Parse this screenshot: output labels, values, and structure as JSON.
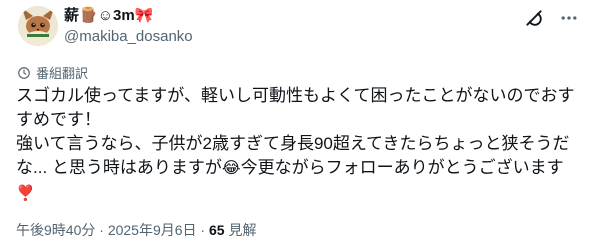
{
  "author": {
    "display_name": "薪",
    "name_decoration": "🪵☺3m🎀",
    "handle": "@makiba_dosanko"
  },
  "icons": {
    "avatar": "eevee-avatar",
    "grok": "grok-icon",
    "more": "more-icon",
    "translate": "translate-icon"
  },
  "translate_label": "番組翻訳",
  "tweet": {
    "line1": "スゴカル使ってますが、軽いし可動性もよくて困ったことがないのでおすすめです！",
    "line2_a": "強いて言うなら、子供が2歳すぎて身長90超えてきたらちょっと狭そうだな... と思う時はありますが",
    "emoji": "😂",
    "line2_b": "今更ながらフォローありがとうございます",
    "heart": "❣️"
  },
  "meta": {
    "time": "午後9時40分",
    "separator": " · ",
    "date": "2025年9月6日",
    "views_count": "65",
    "views_label": " 見解"
  },
  "colors": {
    "text": "#0f1419",
    "secondary": "#536471",
    "heart": "#e0245e"
  }
}
